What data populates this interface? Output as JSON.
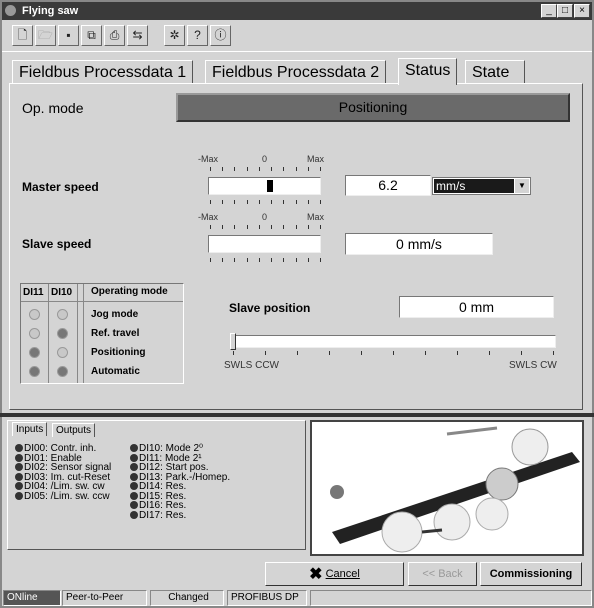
{
  "window": {
    "title": "Flying saw"
  },
  "toolbar": {
    "icons": [
      "new-icon",
      "open-icon",
      "save-icon",
      "copy-icon",
      "print-icon",
      "transfer-icon",
      "tools-icon",
      "help-icon",
      "info-icon"
    ]
  },
  "tabs": [
    {
      "label": "Fieldbus Processdata 1"
    },
    {
      "label": "Fieldbus Processdata 2"
    },
    {
      "label": "Status",
      "active": true
    },
    {
      "label": "State"
    }
  ],
  "status": {
    "op_mode_label": "Op. mode",
    "op_mode_value": "Positioning",
    "scale": {
      "min": "-Max",
      "zero": "0",
      "max": "Max"
    },
    "master_speed": {
      "label": "Master speed",
      "value": "6.2",
      "unit": "mm/s",
      "bar_fraction": 0.03
    },
    "slave_speed": {
      "label": "Slave speed",
      "value": "0 mm/s"
    },
    "mode_table": {
      "headers": [
        "DI11",
        "DI10",
        "Operating mode"
      ],
      "rows": [
        {
          "di11": false,
          "di10": false,
          "mode": "Jog mode"
        },
        {
          "di11": false,
          "di10": true,
          "mode": "Ref. travel"
        },
        {
          "di11": true,
          "di10": false,
          "mode": "Positioning"
        },
        {
          "di11": true,
          "di10": true,
          "mode": "Automatic"
        }
      ]
    },
    "slave_position": {
      "label": "Slave position",
      "value": "0 mm",
      "min_label": "SWLS CCW",
      "max_label": "SWLS CW",
      "slider_fraction": 0
    }
  },
  "io": {
    "tabs": [
      "Inputs",
      "Outputs"
    ],
    "col1": [
      "DI00: Contr. inh.",
      "DI01: Enable",
      "DI02: Sensor signal",
      "DI03: Im. cut-Reset",
      "DI04: /Lim. sw. cw",
      "DI05: /Lim. sw. ccw"
    ],
    "col2": [
      "DI10: Mode 2⁰",
      "DI11: Mode 2¹",
      "DI12: Start pos.",
      "DI13: Park.-/Homep.",
      "DI14: Res.",
      "DI15: Res.",
      "DI16: Res.",
      "DI17: Res."
    ]
  },
  "buttons": {
    "cancel": "Cancel",
    "back": "<< Back",
    "commissioning": "Commissioning"
  },
  "statusbar": [
    "ONline",
    "Peer-to-Peer",
    "Changed",
    "PROFIBUS DP"
  ],
  "colors": {
    "title_bar": "#3a3a3a",
    "op_mode_bg": "#6a6a6a",
    "online_bg": "#555555"
  }
}
